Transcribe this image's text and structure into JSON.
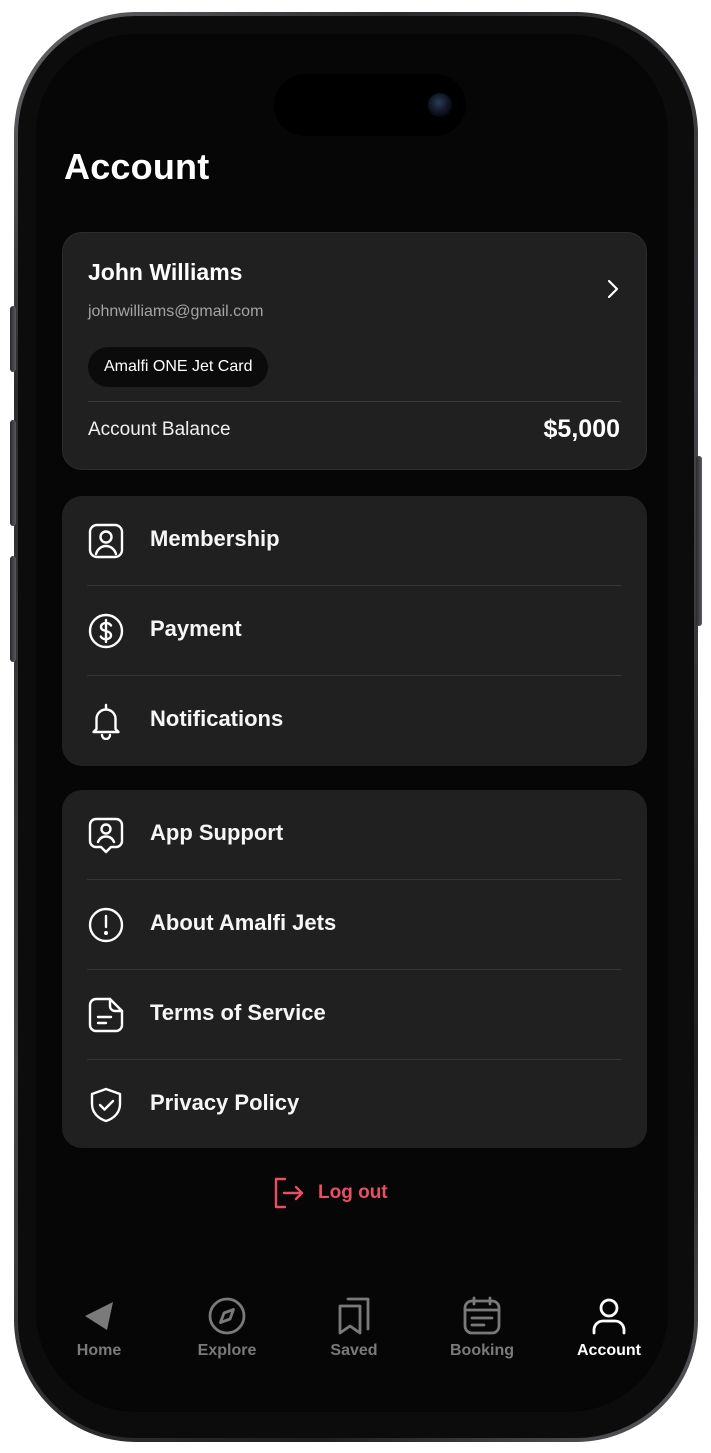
{
  "page": {
    "title": "Account"
  },
  "profile": {
    "name": "John Williams",
    "email": "johnwilliams@gmail.com",
    "badge": "Amalfi ONE Jet Card",
    "balance_label": "Account Balance",
    "balance_value": "$5,000"
  },
  "menu_group_1": {
    "items": [
      {
        "label": "Membership",
        "icon": "user-square-icon"
      },
      {
        "label": "Payment",
        "icon": "dollar-circle-icon"
      },
      {
        "label": "Notifications",
        "icon": "bell-icon"
      }
    ]
  },
  "menu_group_2": {
    "items": [
      {
        "label": "App Support",
        "icon": "support-agent-icon"
      },
      {
        "label": "About Amalfi Jets",
        "icon": "info-circle-icon"
      },
      {
        "label": "Terms of Service",
        "icon": "document-icon"
      },
      {
        "label": "Privacy Policy",
        "icon": "shield-check-icon"
      }
    ]
  },
  "logout": {
    "label": "Log out",
    "color": "#ea4e63"
  },
  "tabbar": {
    "tabs": [
      {
        "label": "Home",
        "icon": "plane-arrow-icon",
        "active": false
      },
      {
        "label": "Explore",
        "icon": "compass-icon",
        "active": false
      },
      {
        "label": "Saved",
        "icon": "bookmarks-icon",
        "active": false
      },
      {
        "label": "Booking",
        "icon": "calendar-list-icon",
        "active": false
      },
      {
        "label": "Account",
        "icon": "user-icon",
        "active": true
      }
    ]
  },
  "colors": {
    "background": "#060606",
    "card": "#202020",
    "accent": "#ea4e63",
    "inactive_tab": "#7a7a7a"
  }
}
